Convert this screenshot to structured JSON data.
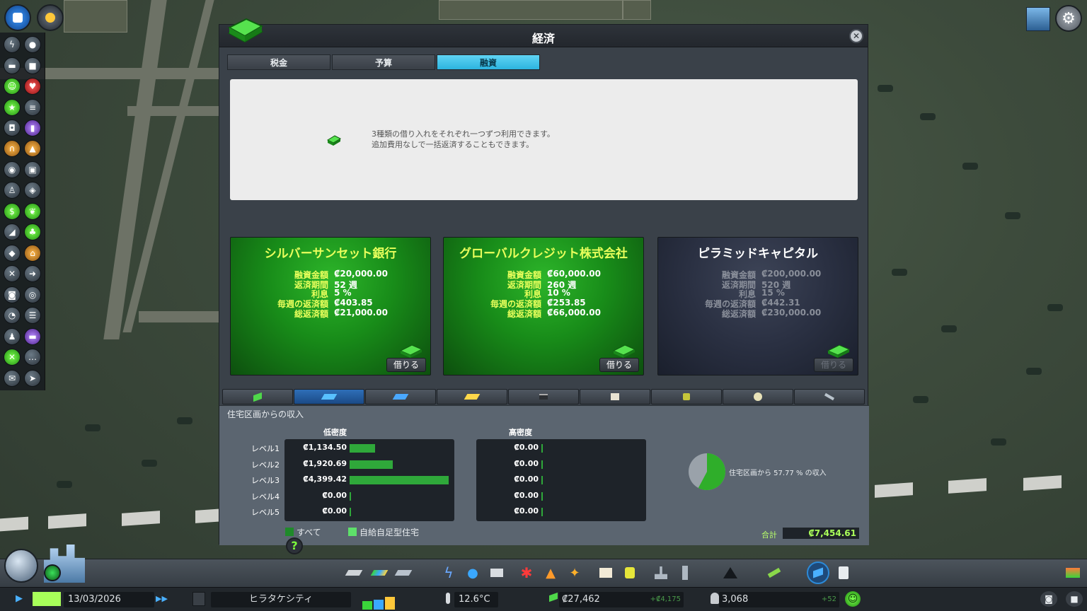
{
  "panel": {
    "title": "経済",
    "close_symbol": "✕",
    "tabs": [
      {
        "label": "税金",
        "active": false
      },
      {
        "label": "予算",
        "active": false
      },
      {
        "label": "融資",
        "active": true
      }
    ]
  },
  "loan_info": {
    "line1": "3種類の借り入れをそれぞれ一つずつ利用できます。",
    "line2": "追加費用なしで一括返済することもできます。"
  },
  "loan_labels": {
    "amount": "融資金額",
    "period": "返済期間",
    "interest": "利息",
    "weekly": "毎週の返済額",
    "total": "総返済額"
  },
  "loans": [
    {
      "name": "シルバーサンセット銀行",
      "amount": "₡20,000.00",
      "period": "52 週",
      "interest": "5 %",
      "weekly": "₡403.85",
      "total": "₡21,000.00",
      "button": "借りる",
      "available": true
    },
    {
      "name": "グローバルクレジット株式会社",
      "amount": "₡60,000.00",
      "period": "260 週",
      "interest": "10 %",
      "weekly": "₡253.85",
      "total": "₡66,000.00",
      "button": "借りる",
      "available": true
    },
    {
      "name": "ピラミッドキャピタル",
      "amount": "₡200,000.00",
      "period": "520 週",
      "interest": "15 %",
      "weekly": "₡442.31",
      "total": "₡230,000.00",
      "button": "借りる",
      "available": false
    }
  ],
  "income_tabs": [
    "money-icon",
    "residential-icon",
    "commercial-icon",
    "office-icon",
    "industry-icon",
    "education-icon",
    "transport-icon",
    "tourism-icon",
    "resource-icon"
  ],
  "income": {
    "title": "住宅区画からの収入",
    "low_density_label": "低密度",
    "high_density_label": "高密度",
    "levels": [
      "レベル1",
      "レベル2",
      "レベル3",
      "レベル4",
      "レベル5"
    ],
    "low_values": [
      "₡1,134.50",
      "₡1,920.69",
      "₡4,399.42",
      "₡0.00",
      "₡0.00"
    ],
    "low_amounts": [
      1134.5,
      1920.69,
      4399.42,
      0,
      0
    ],
    "high_values": [
      "₡0.00",
      "₡0.00",
      "₡0.00",
      "₡0.00",
      "₡0.00"
    ],
    "legend_all": "すべて",
    "legend_self": "自給自足型住宅",
    "share_text": "住宅区画から 57.77 % の収入",
    "share_percent": 57.77,
    "total_label": "合計",
    "total_value": "₡7,454.61",
    "help_symbol": "?"
  },
  "status": {
    "date": "13/03/2026",
    "city_name": "ヒラタケシティ",
    "temperature": "12.6°C",
    "money": "₡27,462",
    "money_change": "+₡4,175",
    "population": "3,068",
    "population_change": "+52"
  },
  "colors": {
    "accent_tab": "#2cb4e0",
    "loan_green": "#188c19",
    "bar_green": "#2fa83a",
    "total_green": "#aaff5a",
    "card_title": "#e9ff5c"
  }
}
